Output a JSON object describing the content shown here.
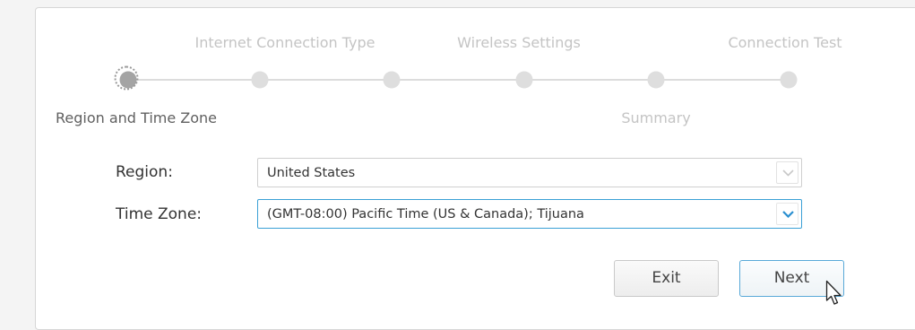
{
  "wizard": {
    "steps": [
      {
        "label": "Region and Time Zone",
        "state": "current"
      },
      {
        "label": "Internet Connection Type",
        "state": "pending"
      },
      {
        "label": "",
        "state": "pending"
      },
      {
        "label": "Wireless Settings",
        "state": "pending"
      },
      {
        "label": "Summary",
        "state": "pending"
      },
      {
        "label": "Connection Test",
        "state": "pending"
      }
    ]
  },
  "form": {
    "region": {
      "label": "Region:",
      "value": "United States"
    },
    "timezone": {
      "label": "Time Zone:",
      "value": "(GMT-08:00) Pacific Time (US & Canada); Tijuana"
    }
  },
  "buttons": {
    "exit": "Exit",
    "next": "Next"
  },
  "colors": {
    "focus_border": "#3aa0d6",
    "chevron_active": "#2a8fd0",
    "chevron_inactive": "#c8c8c8"
  }
}
